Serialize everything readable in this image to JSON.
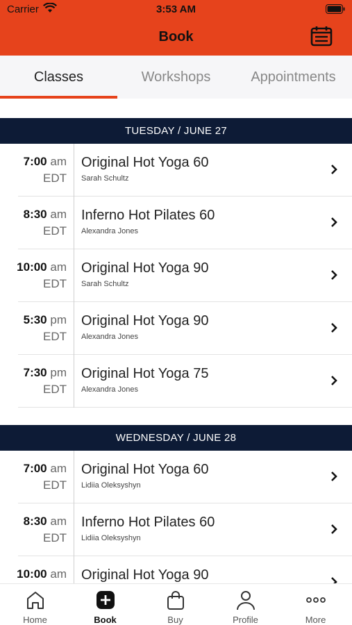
{
  "status_bar": {
    "carrier": "Carrier",
    "time": "3:53 AM"
  },
  "header": {
    "title": "Book",
    "calendar_icon": "calendar-icon",
    "background": "#e6431c"
  },
  "tabs": [
    {
      "label": "Classes",
      "active": true
    },
    {
      "label": "Workshops",
      "active": false
    },
    {
      "label": "Appointments",
      "active": false
    }
  ],
  "days": [
    {
      "label": "TUESDAY / JUNE 27",
      "classes": [
        {
          "time": "7:00",
          "ampm": "am",
          "tz": "EDT",
          "title": "Original Hot Yoga 60",
          "instructor": "Sarah Schultz"
        },
        {
          "time": "8:30",
          "ampm": "am",
          "tz": "EDT",
          "title": "Inferno Hot Pilates 60",
          "instructor": "Alexandra Jones"
        },
        {
          "time": "10:00",
          "ampm": "am",
          "tz": "EDT",
          "title": "Original Hot Yoga 90",
          "instructor": "Sarah Schultz"
        },
        {
          "time": "5:30",
          "ampm": "pm",
          "tz": "EDT",
          "title": "Original Hot Yoga 90",
          "instructor": "Alexandra Jones"
        },
        {
          "time": "7:30",
          "ampm": "pm",
          "tz": "EDT",
          "title": "Original Hot Yoga 75",
          "instructor": "Alexandra Jones"
        }
      ]
    },
    {
      "label": "WEDNESDAY / JUNE 28",
      "classes": [
        {
          "time": "7:00",
          "ampm": "am",
          "tz": "EDT",
          "title": "Original Hot Yoga 60",
          "instructor": "Lidiia Oleksyshyn"
        },
        {
          "time": "8:30",
          "ampm": "am",
          "tz": "EDT",
          "title": "Inferno Hot Pilates 60",
          "instructor": "Lidiia Oleksyshyn"
        },
        {
          "time": "10:00",
          "ampm": "am",
          "tz": "",
          "title": "Original Hot Yoga 90",
          "instructor": ""
        }
      ]
    }
  ],
  "tab_bar": [
    {
      "label": "Home",
      "icon": "home-icon",
      "active": false
    },
    {
      "label": "Book",
      "icon": "plus-square-icon",
      "active": true
    },
    {
      "label": "Buy",
      "icon": "shopping-bag-icon",
      "active": false
    },
    {
      "label": "Profile",
      "icon": "person-icon",
      "active": false
    },
    {
      "label": "More",
      "icon": "more-dots-icon",
      "active": false
    }
  ]
}
